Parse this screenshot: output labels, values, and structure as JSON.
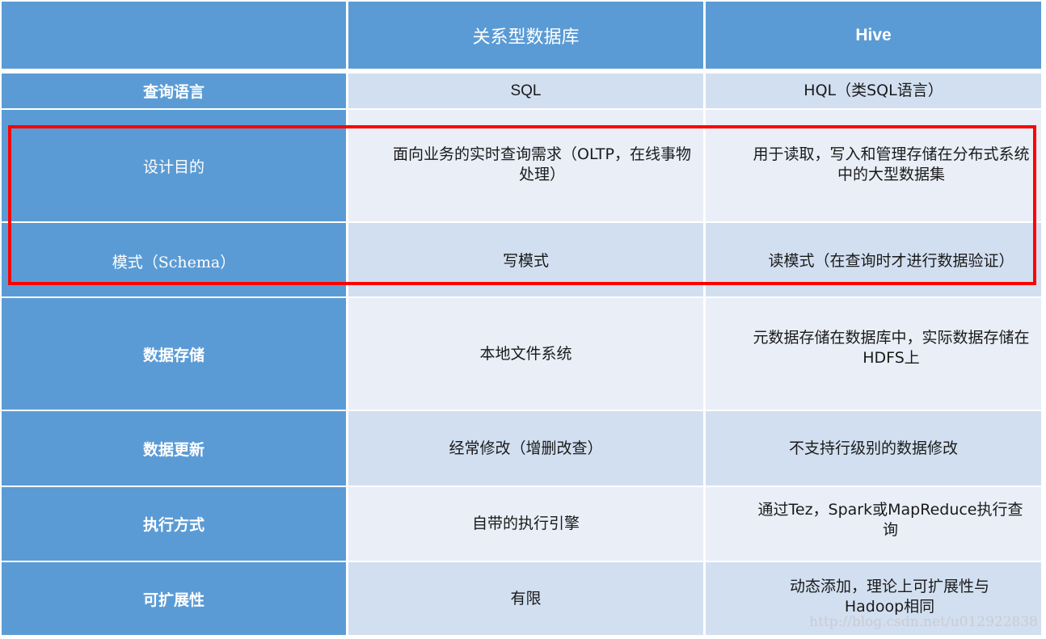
{
  "table": {
    "headers": [
      "",
      "关系型数据库",
      "Hive"
    ],
    "rows": [
      {
        "label": "查询语言",
        "rdbms": "SQL",
        "hive": "HQL（类SQL语言）"
      },
      {
        "label": "设计目的",
        "rdbms": "面向业务的实时查询需求（OLTP，在线事物处理）",
        "hive": "用于读取，写入和管理存储在分布式系统中的大型数据集"
      },
      {
        "label": "模式（Schema）",
        "rdbms": "写模式",
        "hive": "读模式（在查询时才进行数据验证）"
      },
      {
        "label": "数据存储",
        "rdbms": "本地文件系统",
        "hive": "元数据存储在数据库中，实际数据存储在HDFS上"
      },
      {
        "label": "数据更新",
        "rdbms": "经常修改（增删改查）",
        "hive": "不支持行级别的数据修改"
      },
      {
        "label": "执行方式",
        "rdbms": "自带的执行引擎",
        "hive": "通过Tez，Spark或MapReduce执行查询"
      },
      {
        "label": "可扩展性",
        "rdbms": "有限",
        "hive": "动态添加，理论上可扩展性与Hadoop相同"
      }
    ]
  },
  "highlight": {
    "rows": [
      "设计目的",
      "模式（Schema）"
    ],
    "color": "#ff0000"
  },
  "colors": {
    "header_bg": "#5b9bd5",
    "row_odd_bg": "#d2dff0",
    "row_even_bg": "#e9eef7"
  },
  "watermark": "http://blog.csdn.net/u012922838"
}
